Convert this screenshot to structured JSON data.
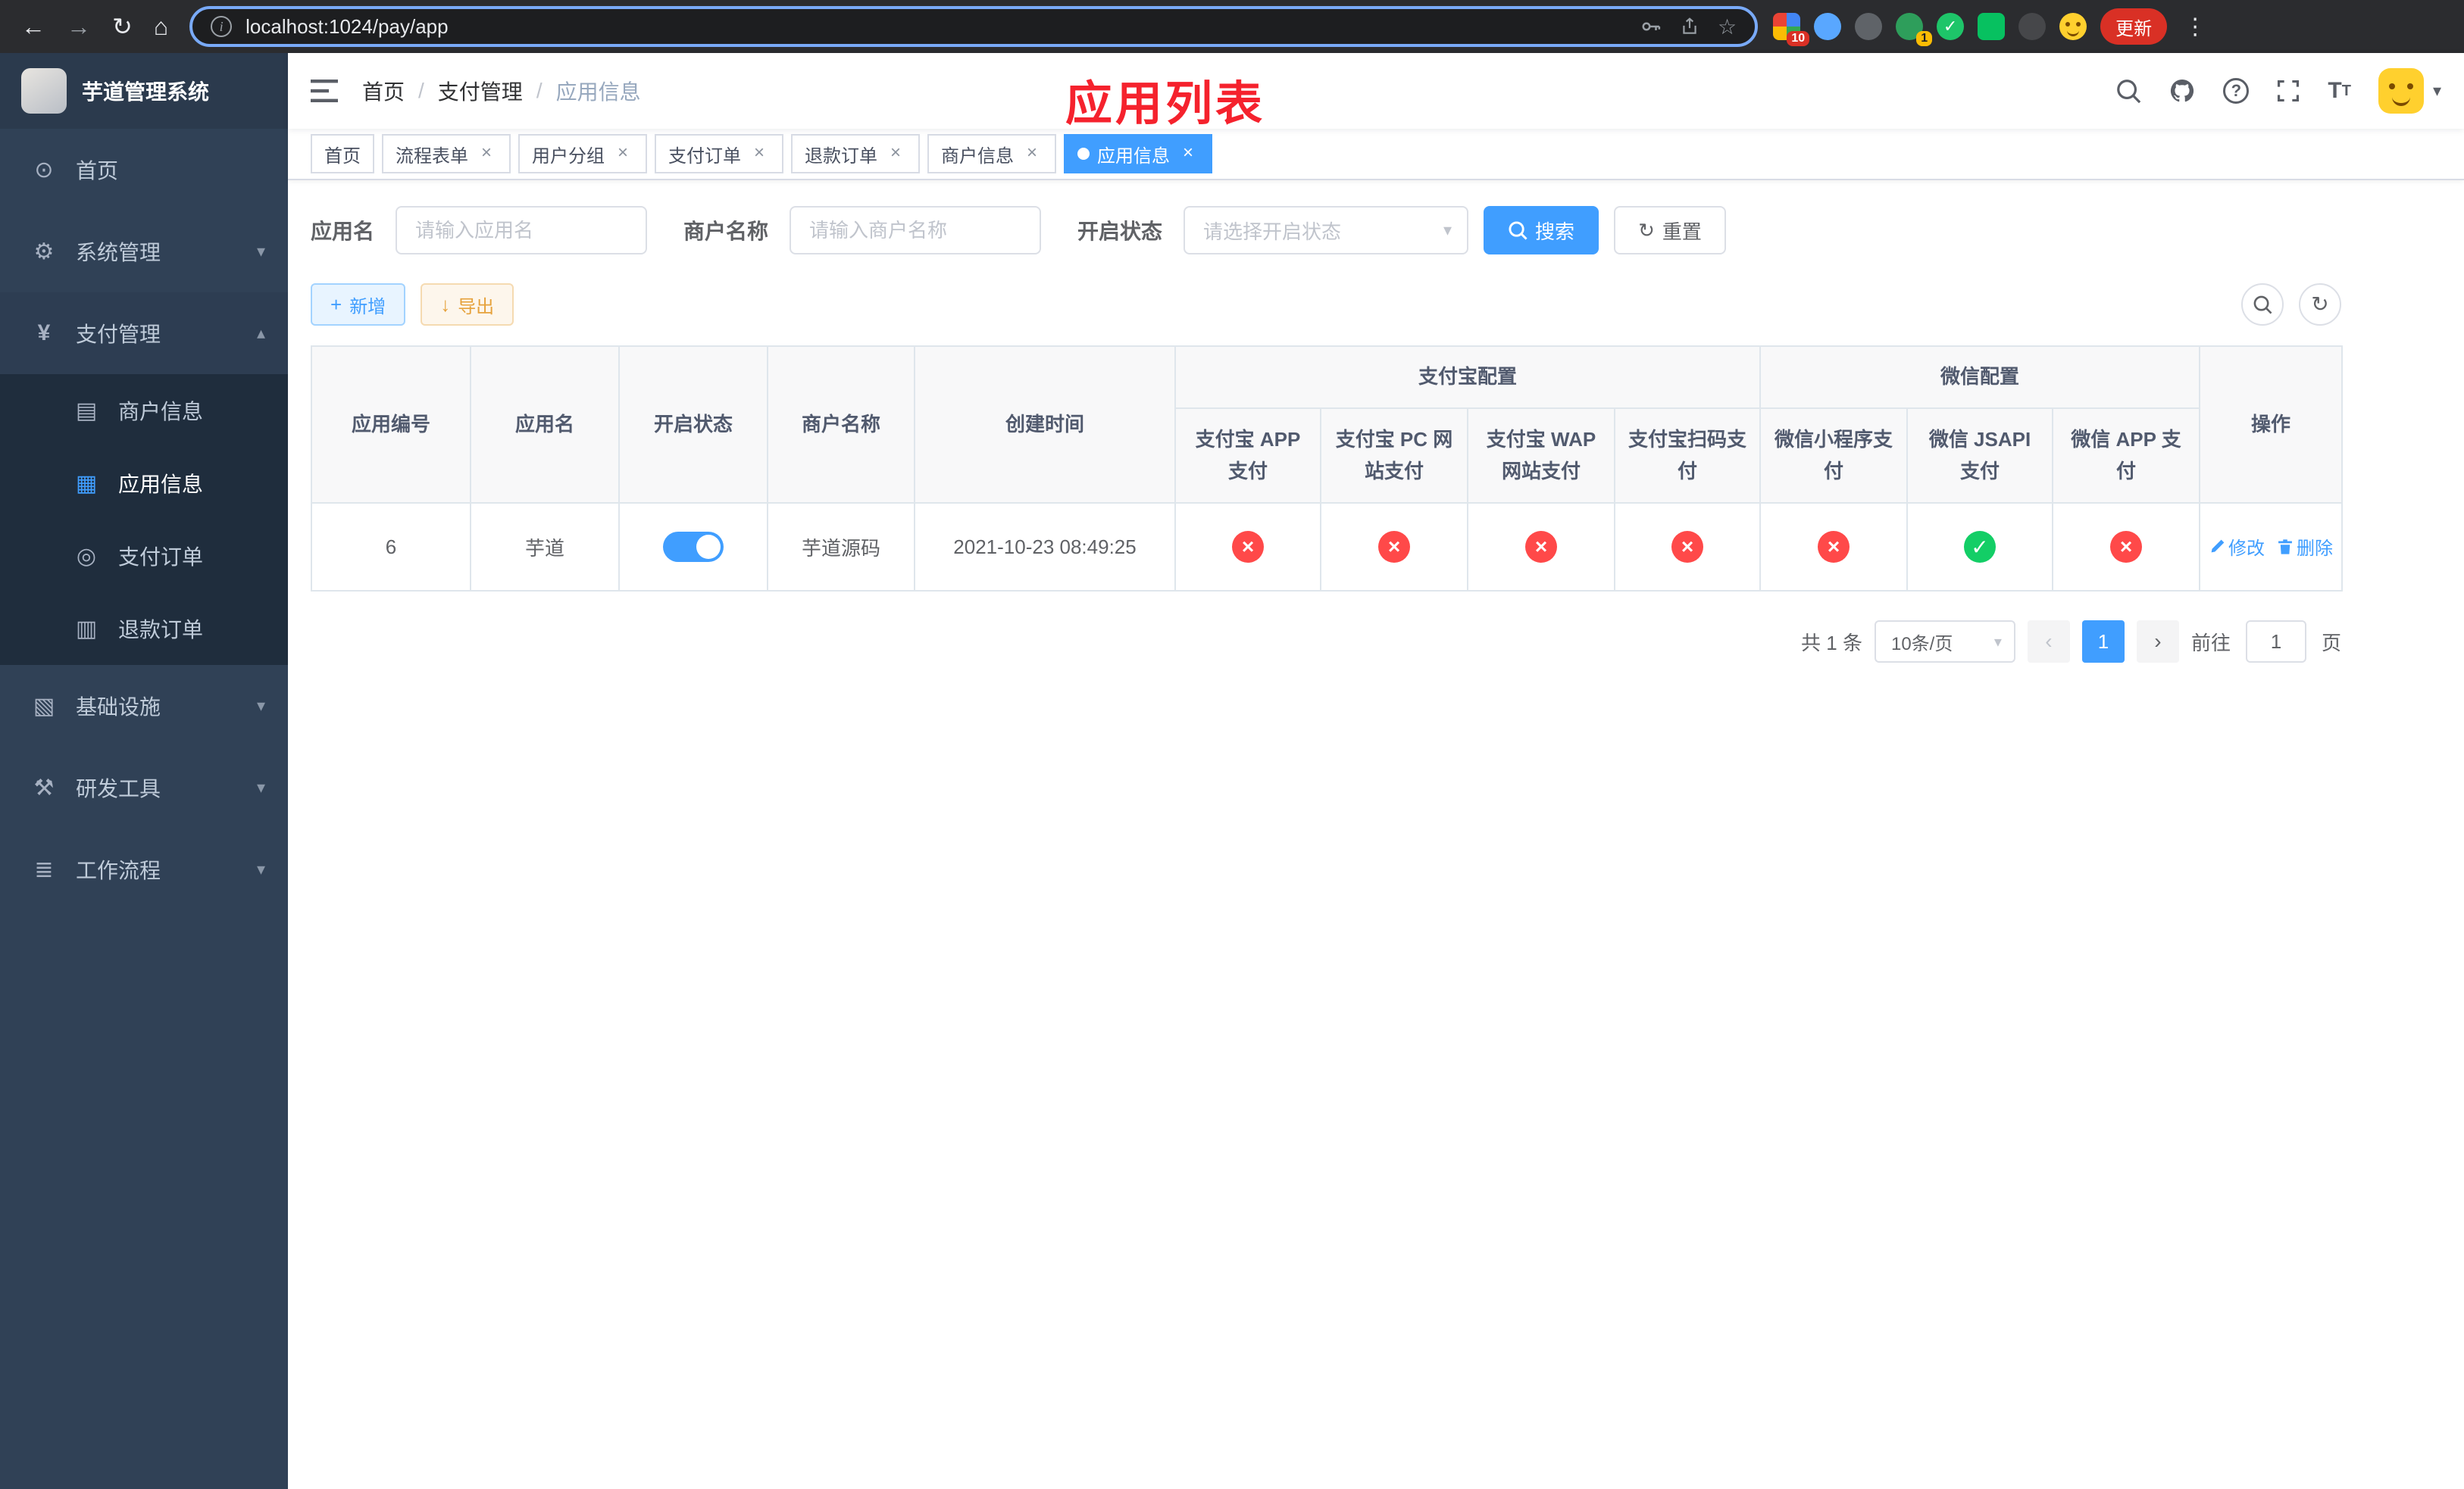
{
  "browser": {
    "url": "localhost:1024/pay/app",
    "update_button": "更新",
    "ext_badges": {
      "grid": "10",
      "avatar": "1"
    }
  },
  "sidebar": {
    "title": "芋道管理系统",
    "menu": [
      {
        "icon": "dashboard-icon",
        "label": "首页"
      },
      {
        "icon": "gear-icon",
        "label": "系统管理"
      },
      {
        "icon": "yen-icon",
        "label": "支付管理"
      },
      {
        "icon": "merchant-icon",
        "label": "商户信息"
      },
      {
        "icon": "app-grid-icon",
        "label": "应用信息"
      },
      {
        "icon": "pay-order-icon",
        "label": "支付订单"
      },
      {
        "icon": "refund-order-icon",
        "label": "退款订单"
      },
      {
        "icon": "infrastructure-icon",
        "label": "基础设施"
      },
      {
        "icon": "devtools-icon",
        "label": "研发工具"
      },
      {
        "icon": "workflow-icon",
        "label": "工作流程"
      }
    ]
  },
  "navbar": {
    "breadcrumb": {
      "home": "首页",
      "section": "支付管理",
      "current": "应用信息"
    },
    "overlay_title": "应用列表"
  },
  "tabs": [
    {
      "label": "首页"
    },
    {
      "label": "流程表单"
    },
    {
      "label": "用户分组"
    },
    {
      "label": "支付订单"
    },
    {
      "label": "退款订单"
    },
    {
      "label": "商户信息"
    },
    {
      "label": "应用信息"
    }
  ],
  "filters": {
    "app_name_label": "应用名",
    "app_name_placeholder": "请输入应用名",
    "merchant_label": "商户名称",
    "merchant_placeholder": "请输入商户名称",
    "status_label": "开启状态",
    "status_placeholder": "请选择开启状态",
    "search_button": "搜索",
    "reset_button": "重置"
  },
  "toolbar": {
    "add_button": "新增",
    "export_button": "导出"
  },
  "table": {
    "left_columns": [
      "应用编号",
      "应用名",
      "开启状态",
      "商户名称",
      "创建时间"
    ],
    "alipay_group": "支付宝配置",
    "alipay_columns": [
      "支付宝 APP 支付",
      "支付宝 PC 网站支付",
      "支付宝 WAP 网站支付",
      "支付宝扫码支付"
    ],
    "wechat_group": "微信配置",
    "wechat_columns": [
      "微信小程序支付",
      "微信 JSAPI 支付",
      "微信 APP 支付"
    ],
    "action_column": "操作",
    "row": {
      "id": "6",
      "name": "芋道",
      "switch_state": "on",
      "merchant": "芋道源码",
      "created": "2021-10-23 08:49:25",
      "statuses": [
        "fail",
        "fail",
        "fail",
        "fail",
        "fail",
        "success",
        "fail"
      ],
      "edit_label": "修改",
      "delete_label": "删除"
    }
  },
  "pagination": {
    "total": "共 1 条",
    "page_size": "10条/页",
    "current_page": "1",
    "goto_label": "前往",
    "goto_value": "1",
    "goto_suffix": "页"
  },
  "colors": {
    "accent": "#409eff",
    "success": "#13ce66",
    "danger": "#ff4949",
    "overlay_title_red": "#f5222d",
    "sidebar_bg": "#304156",
    "submenu_bg": "#1f2d3d"
  }
}
